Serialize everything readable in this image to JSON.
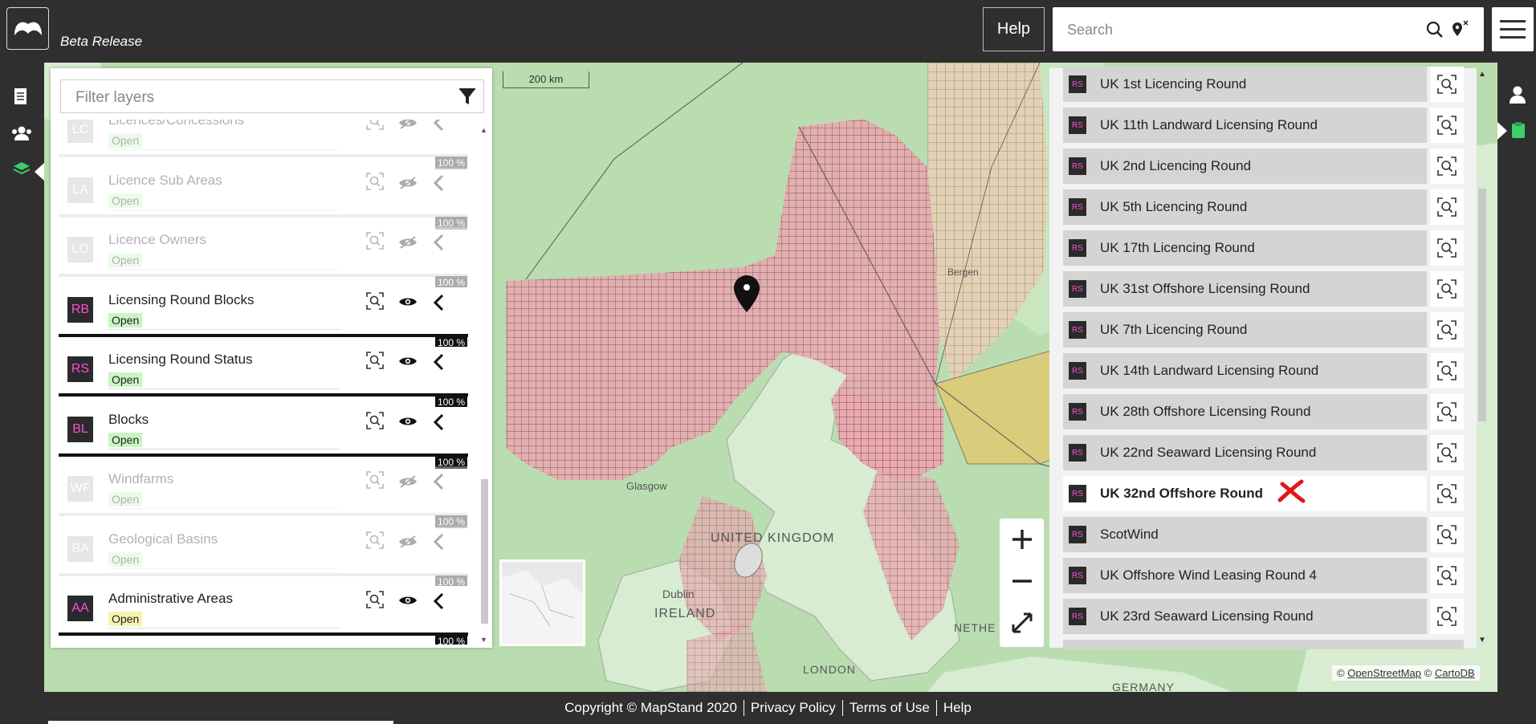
{
  "app": {
    "subtitle": "Beta Release",
    "help_label": "Help",
    "search_placeholder": "Search",
    "icons": {
      "logo": "mapstand-logo-icon",
      "search": "search-icon",
      "pin": "clear-location-icon",
      "menu": "hamburger-menu-icon"
    }
  },
  "left_rail": {
    "items": [
      {
        "name": "documents-icon"
      },
      {
        "name": "users-icon"
      },
      {
        "name": "layers-icon",
        "active": true
      }
    ]
  },
  "right_rail": {
    "items": [
      {
        "name": "user-profile-icon"
      },
      {
        "name": "clipboard-icon",
        "active": true
      }
    ]
  },
  "layers_panel": {
    "filter_placeholder": "Filter layers",
    "layers": [
      {
        "code": "LC",
        "name": "Licences/Concessions",
        "status": "Open",
        "percent": "100 %",
        "enabled": false
      },
      {
        "code": "LA",
        "name": "Licence Sub Areas",
        "status": "Open",
        "percent": "100 %",
        "enabled": false
      },
      {
        "code": "LO",
        "name": "Licence Owners",
        "status": "Open",
        "percent": "100 %",
        "enabled": false
      },
      {
        "code": "RB",
        "name": "Licensing Round Blocks",
        "status": "Open",
        "percent": "100 %",
        "enabled": true
      },
      {
        "code": "RS",
        "name": "Licensing Round Status",
        "status": "Open",
        "percent": "100 %",
        "enabled": true
      },
      {
        "code": "BL",
        "name": "Blocks",
        "status": "Open",
        "percent": "100 %",
        "enabled": true
      },
      {
        "code": "WF",
        "name": "Windfarms",
        "status": "Open",
        "percent": "100 %",
        "enabled": false
      },
      {
        "code": "BA",
        "name": "Geological Basins",
        "status": "Open",
        "percent": "100 %",
        "enabled": false
      },
      {
        "code": "AA",
        "name": "Administrative Areas",
        "status": "Open",
        "percent": "100 %",
        "enabled": true
      }
    ]
  },
  "rounds_panel": {
    "badge": "RS",
    "selected_index": 10,
    "rounds": [
      "UK 1st Licencing Round",
      "UK 11th Landward Licensing Round",
      "UK 2nd Licencing Round",
      "UK 5th Licencing Round",
      "UK 17th Licencing Round",
      "UK 31st Offshore Licensing Round",
      "UK 7th Licencing Round",
      "UK 14th Landward Licensing Round",
      "UK 28th Offshore Licensing Round",
      "UK 22nd Seaward Licensing Round",
      "UK 32nd Offshore Round",
      "ScotWind",
      "UK Offshore Wind Leasing Round 4",
      "UK 23rd Seaward Licensing Round"
    ]
  },
  "map": {
    "scale_label": "200 km",
    "labels": [
      "Glasgow",
      "UNITED KINGDOM",
      "Dublin",
      "IRELAND",
      "LONDON",
      "GERMANY",
      "Bergen",
      "NETHE"
    ],
    "attribution_prefix": "©",
    "osm_label": "OpenStreetMap",
    "carto_label": "CartoDB",
    "colors": {
      "sea": "#b9ddb0",
      "land": "#d7ecd0",
      "blocks_pink": "#e8a9b0",
      "blocks_beige": "#e5d2b5",
      "sector_yellow": "#d9cc7a"
    }
  },
  "footer": {
    "copyright": "Copyright © MapStand 2020",
    "privacy": "Privacy Policy",
    "terms": "Terms of Use",
    "help": "Help"
  }
}
